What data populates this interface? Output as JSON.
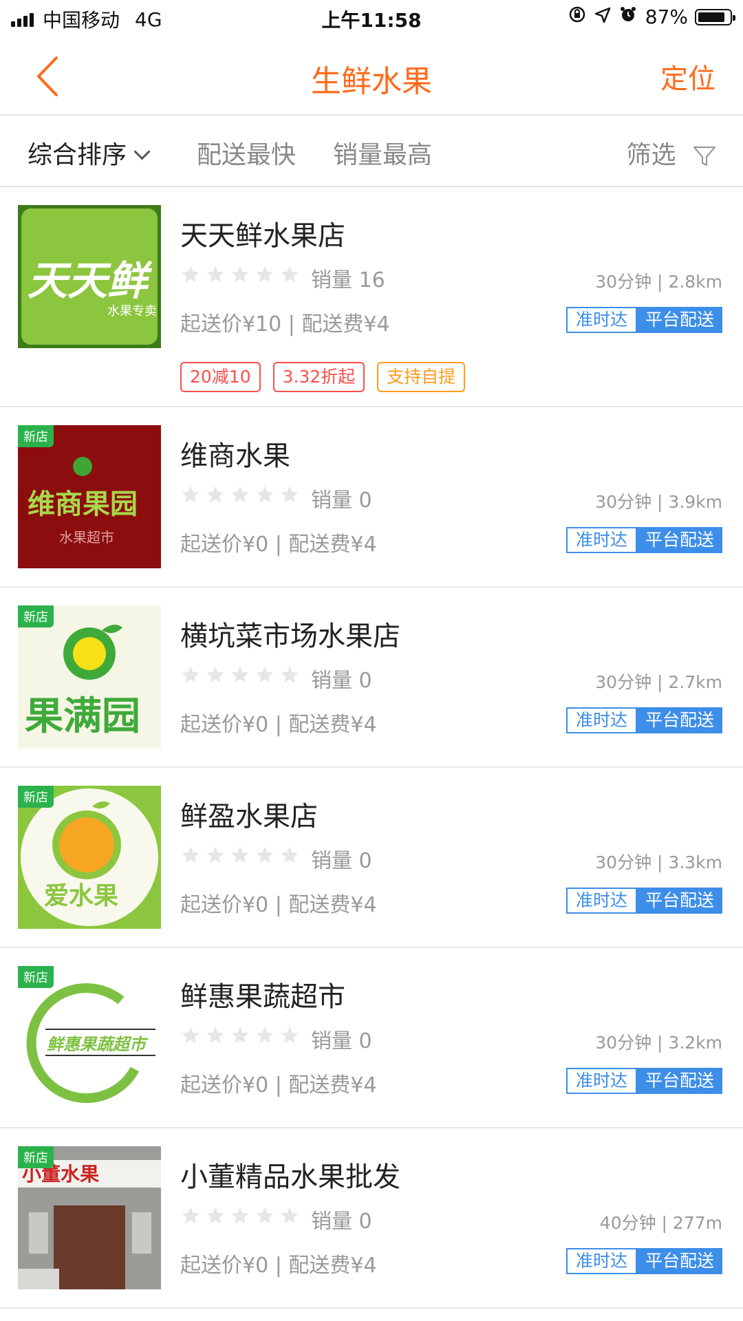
{
  "status_bar": {
    "carrier": "中国移动",
    "network": "4G",
    "time": "上午11:58",
    "battery": "87%",
    "battery_level": 0.87
  },
  "nav": {
    "title": "生鲜水果",
    "right_action": "定位"
  },
  "sort": {
    "items": [
      "综合排序",
      "配送最快",
      "销量最高"
    ],
    "filter": "筛选"
  },
  "colors": {
    "accent": "#ff6a1a",
    "blue_tag": "#3d8ee8",
    "new_tag": "#2bb24c",
    "promo_red": "#ff4d4d",
    "promo_orange": "#ff9b1a"
  },
  "stores": [
    {
      "name": "天天鲜水果店",
      "sales": "销量 16",
      "meta": "起送价¥10 | 配送费¥4",
      "dist": "30分钟 | 2.8km",
      "tag_a": "准时达",
      "tag_b": "平台配送",
      "logo_text": "天天鲜",
      "logo_sub": "水果专卖",
      "promos": [
        "20减10",
        "3.32折起",
        "支持自提"
      ]
    },
    {
      "name": "维商水果",
      "new_label": "新店",
      "sales": "销量 0",
      "meta": "起送价¥0 | 配送费¥4",
      "dist": "30分钟 | 3.9km",
      "tag_a": "准时达",
      "tag_b": "平台配送",
      "logo_text": "维商果园",
      "logo_sub": "水果超市"
    },
    {
      "name": "横坑菜市场水果店",
      "new_label": "新店",
      "sales": "销量 0",
      "meta": "起送价¥0 | 配送费¥4",
      "dist": "30分钟 | 2.7km",
      "tag_a": "准时达",
      "tag_b": "平台配送",
      "logo_text": "果满园"
    },
    {
      "name": "鲜盈水果店",
      "new_label": "新店",
      "sales": "销量 0",
      "meta": "起送价¥0 | 配送费¥4",
      "dist": "30分钟 | 3.3km",
      "tag_a": "准时达",
      "tag_b": "平台配送",
      "logo_text": "爱水果"
    },
    {
      "name": "鲜惠果蔬超市",
      "new_label": "新店",
      "sales": "销量 0",
      "meta": "起送价¥0 | 配送费¥4",
      "dist": "30分钟 | 3.2km",
      "tag_a": "准时达",
      "tag_b": "平台配送",
      "logo_text": "鲜惠果蔬超市"
    },
    {
      "name": "小董精品水果批发",
      "new_label": "新店",
      "sales": "销量 0",
      "meta": "起送价¥0 | 配送费¥4",
      "dist": "40分钟 | 277m",
      "tag_a": "准时达",
      "tag_b": "平台配送",
      "logo_text": "小董水果"
    }
  ]
}
